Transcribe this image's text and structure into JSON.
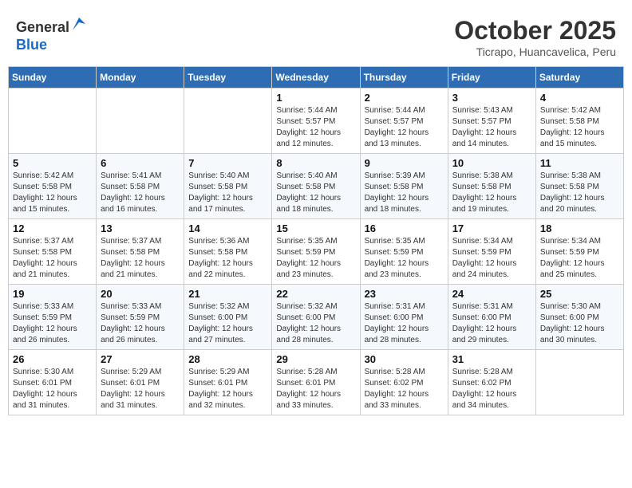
{
  "header": {
    "logo_line1": "General",
    "logo_line2": "Blue",
    "month": "October 2025",
    "location": "Ticrapo, Huancavelica, Peru"
  },
  "weekdays": [
    "Sunday",
    "Monday",
    "Tuesday",
    "Wednesday",
    "Thursday",
    "Friday",
    "Saturday"
  ],
  "weeks": [
    [
      {
        "day": "",
        "info": ""
      },
      {
        "day": "",
        "info": ""
      },
      {
        "day": "",
        "info": ""
      },
      {
        "day": "1",
        "info": "Sunrise: 5:44 AM\nSunset: 5:57 PM\nDaylight: 12 hours\nand 12 minutes."
      },
      {
        "day": "2",
        "info": "Sunrise: 5:44 AM\nSunset: 5:57 PM\nDaylight: 12 hours\nand 13 minutes."
      },
      {
        "day": "3",
        "info": "Sunrise: 5:43 AM\nSunset: 5:57 PM\nDaylight: 12 hours\nand 14 minutes."
      },
      {
        "day": "4",
        "info": "Sunrise: 5:42 AM\nSunset: 5:58 PM\nDaylight: 12 hours\nand 15 minutes."
      }
    ],
    [
      {
        "day": "5",
        "info": "Sunrise: 5:42 AM\nSunset: 5:58 PM\nDaylight: 12 hours\nand 15 minutes."
      },
      {
        "day": "6",
        "info": "Sunrise: 5:41 AM\nSunset: 5:58 PM\nDaylight: 12 hours\nand 16 minutes."
      },
      {
        "day": "7",
        "info": "Sunrise: 5:40 AM\nSunset: 5:58 PM\nDaylight: 12 hours\nand 17 minutes."
      },
      {
        "day": "8",
        "info": "Sunrise: 5:40 AM\nSunset: 5:58 PM\nDaylight: 12 hours\nand 18 minutes."
      },
      {
        "day": "9",
        "info": "Sunrise: 5:39 AM\nSunset: 5:58 PM\nDaylight: 12 hours\nand 18 minutes."
      },
      {
        "day": "10",
        "info": "Sunrise: 5:38 AM\nSunset: 5:58 PM\nDaylight: 12 hours\nand 19 minutes."
      },
      {
        "day": "11",
        "info": "Sunrise: 5:38 AM\nSunset: 5:58 PM\nDaylight: 12 hours\nand 20 minutes."
      }
    ],
    [
      {
        "day": "12",
        "info": "Sunrise: 5:37 AM\nSunset: 5:58 PM\nDaylight: 12 hours\nand 21 minutes."
      },
      {
        "day": "13",
        "info": "Sunrise: 5:37 AM\nSunset: 5:58 PM\nDaylight: 12 hours\nand 21 minutes."
      },
      {
        "day": "14",
        "info": "Sunrise: 5:36 AM\nSunset: 5:58 PM\nDaylight: 12 hours\nand 22 minutes."
      },
      {
        "day": "15",
        "info": "Sunrise: 5:35 AM\nSunset: 5:59 PM\nDaylight: 12 hours\nand 23 minutes."
      },
      {
        "day": "16",
        "info": "Sunrise: 5:35 AM\nSunset: 5:59 PM\nDaylight: 12 hours\nand 23 minutes."
      },
      {
        "day": "17",
        "info": "Sunrise: 5:34 AM\nSunset: 5:59 PM\nDaylight: 12 hours\nand 24 minutes."
      },
      {
        "day": "18",
        "info": "Sunrise: 5:34 AM\nSunset: 5:59 PM\nDaylight: 12 hours\nand 25 minutes."
      }
    ],
    [
      {
        "day": "19",
        "info": "Sunrise: 5:33 AM\nSunset: 5:59 PM\nDaylight: 12 hours\nand 26 minutes."
      },
      {
        "day": "20",
        "info": "Sunrise: 5:33 AM\nSunset: 5:59 PM\nDaylight: 12 hours\nand 26 minutes."
      },
      {
        "day": "21",
        "info": "Sunrise: 5:32 AM\nSunset: 6:00 PM\nDaylight: 12 hours\nand 27 minutes."
      },
      {
        "day": "22",
        "info": "Sunrise: 5:32 AM\nSunset: 6:00 PM\nDaylight: 12 hours\nand 28 minutes."
      },
      {
        "day": "23",
        "info": "Sunrise: 5:31 AM\nSunset: 6:00 PM\nDaylight: 12 hours\nand 28 minutes."
      },
      {
        "day": "24",
        "info": "Sunrise: 5:31 AM\nSunset: 6:00 PM\nDaylight: 12 hours\nand 29 minutes."
      },
      {
        "day": "25",
        "info": "Sunrise: 5:30 AM\nSunset: 6:00 PM\nDaylight: 12 hours\nand 30 minutes."
      }
    ],
    [
      {
        "day": "26",
        "info": "Sunrise: 5:30 AM\nSunset: 6:01 PM\nDaylight: 12 hours\nand 31 minutes."
      },
      {
        "day": "27",
        "info": "Sunrise: 5:29 AM\nSunset: 6:01 PM\nDaylight: 12 hours\nand 31 minutes."
      },
      {
        "day": "28",
        "info": "Sunrise: 5:29 AM\nSunset: 6:01 PM\nDaylight: 12 hours\nand 32 minutes."
      },
      {
        "day": "29",
        "info": "Sunrise: 5:28 AM\nSunset: 6:01 PM\nDaylight: 12 hours\nand 33 minutes."
      },
      {
        "day": "30",
        "info": "Sunrise: 5:28 AM\nSunset: 6:02 PM\nDaylight: 12 hours\nand 33 minutes."
      },
      {
        "day": "31",
        "info": "Sunrise: 5:28 AM\nSunset: 6:02 PM\nDaylight: 12 hours\nand 34 minutes."
      },
      {
        "day": "",
        "info": ""
      }
    ]
  ]
}
